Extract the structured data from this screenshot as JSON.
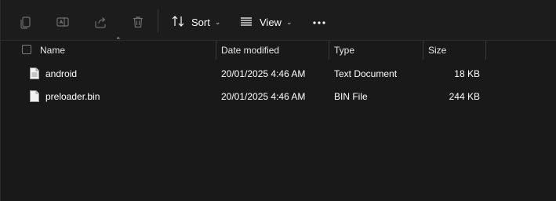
{
  "toolbar": {
    "sort_label": "Sort",
    "view_label": "View",
    "icons": [
      "copy-icon",
      "rename-icon",
      "share-icon",
      "delete-icon",
      "sort-icon",
      "view-icon",
      "more-icon"
    ]
  },
  "columns": {
    "name": "Name",
    "date_modified": "Date modified",
    "type": "Type",
    "size": "Size"
  },
  "files": [
    {
      "name": "android",
      "date_modified": "20/01/2025 4:46 AM",
      "type": "Text Document",
      "size": "18 KB"
    },
    {
      "name": "preloader.bin",
      "date_modified": "20/01/2025 4:46 AM",
      "type": "BIN File",
      "size": "244 KB"
    }
  ],
  "colors": {
    "background": "#191919",
    "toolbar_background": "#1c1c1c",
    "text": "#ffffff",
    "disabled_icon": "#6e6e6e"
  }
}
